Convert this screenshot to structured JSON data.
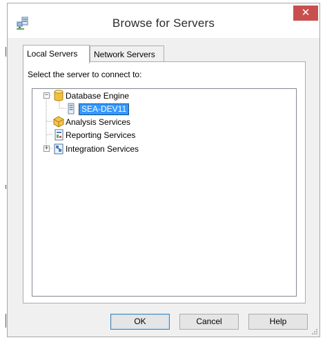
{
  "window": {
    "title": "Browse for Servers",
    "close_glyph": "✕",
    "icon": "server-network-icon"
  },
  "tabs": [
    {
      "label": "Local Servers",
      "active": true
    },
    {
      "label": "Network Servers",
      "active": false
    }
  ],
  "panel": {
    "prompt": "Select the server to connect to:"
  },
  "tree": {
    "items": [
      {
        "label": "Database Engine",
        "icon": "database-engine-icon",
        "expanded": true,
        "expander": "−"
      },
      {
        "label": "SEA-DEV11",
        "icon": "server-instance-icon",
        "selected": true
      },
      {
        "label": "Analysis Services",
        "icon": "analysis-services-icon"
      },
      {
        "label": "Reporting Services",
        "icon": "reporting-services-icon"
      },
      {
        "label": "Integration Services",
        "icon": "integration-services-icon",
        "expanded": false,
        "expander": "+"
      }
    ]
  },
  "buttons": {
    "ok": "OK",
    "cancel": "Cancel",
    "help": "Help"
  },
  "colors": {
    "selection": "#3399ff",
    "close": "#c7504f",
    "dialog_bg": "#f0f0f0"
  }
}
